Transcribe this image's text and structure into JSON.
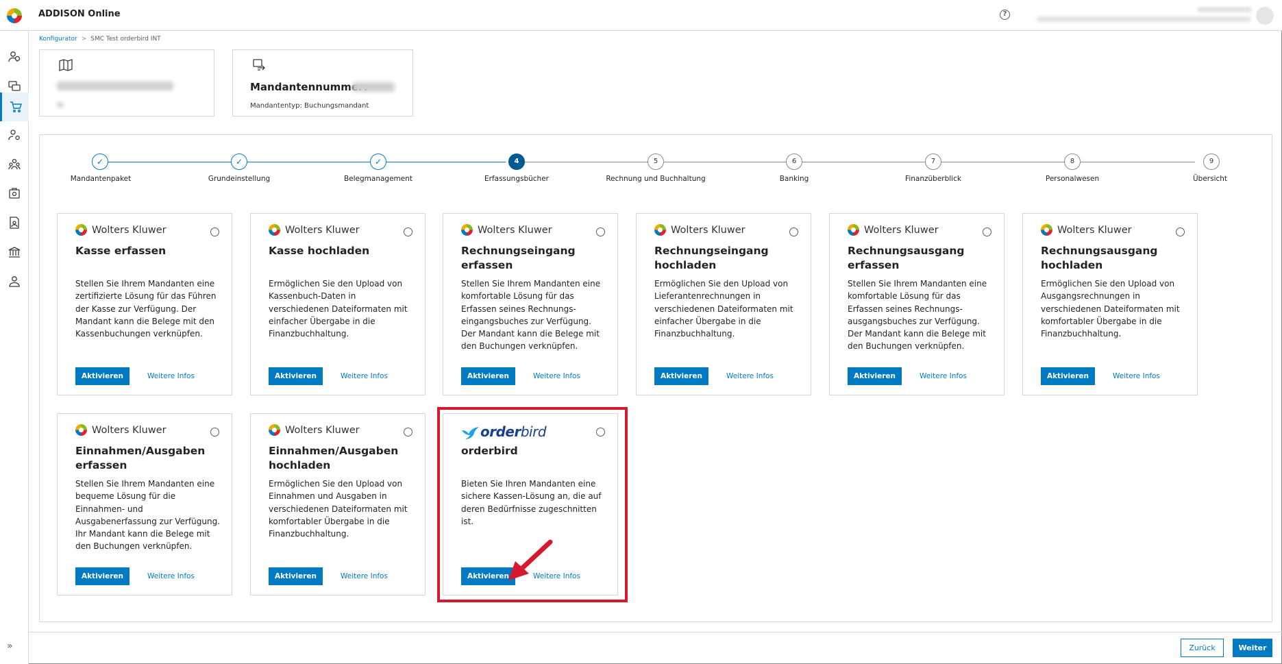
{
  "app": {
    "title": "ADDISON Online",
    "help": "?"
  },
  "breadcrumb": {
    "root": "Konfigurator",
    "separator": ">",
    "current": "SMC Test orderbird INT"
  },
  "header": {
    "client_number_label": "Mandantennummer:",
    "client_type": "Mandantentyp: Buchungsmandant"
  },
  "steps": [
    {
      "label": "Mandantenpaket",
      "state": "done",
      "marker": "✓"
    },
    {
      "label": "Grundeinstellung",
      "state": "done",
      "marker": "✓"
    },
    {
      "label": "Belegmanagement",
      "state": "done",
      "marker": "✓"
    },
    {
      "label": "Erfassungsbücher",
      "state": "current",
      "marker": "4"
    },
    {
      "label": "Rechnung und Buchhaltung",
      "state": "todo",
      "marker": "5"
    },
    {
      "label": "Banking",
      "state": "todo",
      "marker": "6"
    },
    {
      "label": "Finanzüberblick",
      "state": "todo",
      "marker": "7"
    },
    {
      "label": "Personalwesen",
      "state": "todo",
      "marker": "8"
    },
    {
      "label": "Übersicht",
      "state": "todo",
      "marker": "9"
    }
  ],
  "cards": [
    {
      "brand": "Wolters Kluwer",
      "title": "Kasse erfassen",
      "desc": "Stellen Sie Ihrem Mandanten eine zertifizierte Lösung für das Führen der Kasse zur Verfügung. Der Mandant kann die Belege mit den Kassenbuchungen verknüpfen.",
      "activate": "Aktivieren",
      "more": "Weitere Infos"
    },
    {
      "brand": "Wolters Kluwer",
      "title": "Kasse hochladen",
      "desc": "Ermöglichen Sie den Upload von Kassenbuch-Daten in verschiedenen Dateiformaten mit einfacher Übergabe in die Finanzbuchhaltung.",
      "activate": "Aktivieren",
      "more": "Weitere Infos"
    },
    {
      "brand": "Wolters Kluwer",
      "title": "Rechnungseingang erfassen",
      "desc": "Stellen Sie Ihrem Mandanten eine komfortable Lösung für das Erfassen seines Rechnungs-eingangsbuches zur Verfügung. Der Mandant kann die Belege mit den Buchungen verknüpfen.",
      "activate": "Aktivieren",
      "more": "Weitere Infos"
    },
    {
      "brand": "Wolters Kluwer",
      "title": "Rechnungseingang hochladen",
      "desc": "Ermöglichen Sie den Upload von Lieferantenrechnungen in verschiedenen Dateiformaten mit einfacher Übergabe in die Finanzbuchhaltung.",
      "activate": "Aktivieren",
      "more": "Weitere Infos"
    },
    {
      "brand": "Wolters Kluwer",
      "title": "Rechnungsausgang erfassen",
      "desc": "Stellen Sie Ihrem Mandanten eine komfortable Lösung für das Erfassen seines Rechnungs-ausgangsbuches zur Verfügung. Der Mandant kann die Belege mit den Buchungen verknüpfen.",
      "activate": "Aktivieren",
      "more": "Weitere Infos"
    },
    {
      "brand": "Wolters Kluwer",
      "title": "Rechnungsausgang hochladen",
      "desc": "Ermöglichen Sie den Upload von Ausgangsrechnungen in verschiedenen Dateiformaten mit komfortabler Übergabe in die Finanzbuchhaltung.",
      "activate": "Aktivieren",
      "more": "Weitere Infos"
    },
    {
      "brand": "Wolters Kluwer",
      "title": "Einnahmen/Ausgaben erfassen",
      "desc": "Stellen Sie Ihrem Mandanten eine bequeme Lösung für die Einnahmen- und Ausgabenerfassung zur Verfügung. Ihr Mandant kann die Belege mit den Buchungen verknüpfen.",
      "activate": "Aktivieren",
      "more": "Weitere Infos"
    },
    {
      "brand": "Wolters Kluwer",
      "title": "Einnahmen/Ausgaben hochladen",
      "desc": "Ermöglichen Sie den Upload von Einnahmen und Ausgaben in verschiedenen Dateiformaten mit komfortabler Übergabe in die Finanzbuchhaltung.",
      "activate": "Aktivieren",
      "more": "Weitere Infos"
    },
    {
      "brand_a": "order",
      "brand_b": "bird",
      "title": "orderbird",
      "desc": "Bieten Sie Ihren Mandanten eine sichere Kassen-Lösung an, die auf deren Bedürfnisse zugeschnitten ist.",
      "activate": "Aktivieren",
      "more": "Weitere Infos"
    }
  ],
  "footer": {
    "back": "Zurück",
    "next": "Weiter"
  },
  "colors": {
    "accent": "#007ac3",
    "highlight": "#d7192f"
  }
}
